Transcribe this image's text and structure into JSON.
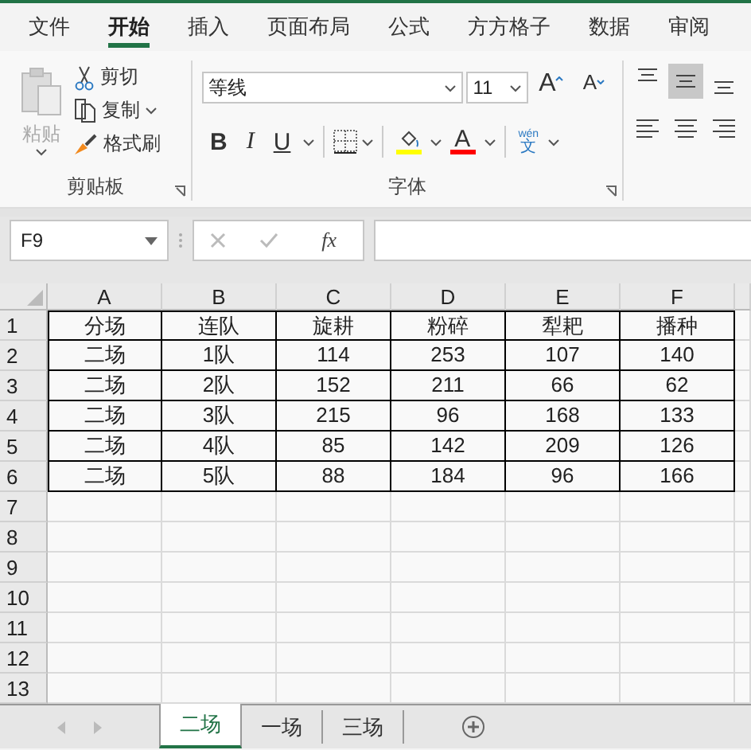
{
  "menu_tabs": [
    {
      "label": "文件",
      "selected": false
    },
    {
      "label": "开始",
      "selected": true
    },
    {
      "label": "插入",
      "selected": false
    },
    {
      "label": "页面布局",
      "selected": false
    },
    {
      "label": "公式",
      "selected": false
    },
    {
      "label": "方方格子",
      "selected": false
    },
    {
      "label": "数据",
      "selected": false
    },
    {
      "label": "审阅",
      "selected": false
    }
  ],
  "clipboard": {
    "paste": "粘贴",
    "cut": "剪切",
    "copy": "复制",
    "format_painter": "格式刷",
    "label": "剪贴板"
  },
  "font": {
    "name": "等线",
    "size": "11",
    "grow": "A",
    "shrink": "A",
    "bold": "B",
    "italic": "I",
    "underline": "U",
    "font_color": "A",
    "phonetic_top": "wén",
    "phonetic_bottom": "文",
    "label": "字体"
  },
  "alignment": [
    {
      "selected": false
    },
    {
      "selected": true
    },
    {
      "selected": false
    }
  ],
  "name_box": "F9",
  "formula_button": "fx",
  "sheet": {
    "columns": [
      "A",
      "B",
      "C",
      "D",
      "E",
      "F"
    ],
    "rows": [
      {
        "number": "1",
        "cells": [
          "分场",
          "连队",
          "旋耕",
          "粉碎",
          "犁耙",
          "播种"
        ]
      },
      {
        "number": "2",
        "cells": [
          "二场",
          "1队",
          "114",
          "253",
          "107",
          "140"
        ]
      },
      {
        "number": "3",
        "cells": [
          "二场",
          "2队",
          "152",
          "211",
          "66",
          "62"
        ]
      },
      {
        "number": "4",
        "cells": [
          "二场",
          "3队",
          "215",
          "96",
          "168",
          "133"
        ]
      },
      {
        "number": "5",
        "cells": [
          "二场",
          "4队",
          "85",
          "142",
          "209",
          "126"
        ]
      },
      {
        "number": "6",
        "cells": [
          "二场",
          "5队",
          "88",
          "184",
          "96",
          "166"
        ]
      },
      {
        "number": "7",
        "cells": []
      },
      {
        "number": "8",
        "cells": []
      },
      {
        "number": "9",
        "cells": []
      },
      {
        "number": "10",
        "cells": []
      },
      {
        "number": "11",
        "cells": []
      },
      {
        "number": "12",
        "cells": []
      },
      {
        "number": "13",
        "cells": []
      }
    ]
  },
  "sheet_tabs": [
    {
      "label": "二场",
      "selected": true
    },
    {
      "label": "一场",
      "selected": false
    },
    {
      "label": "三场",
      "selected": false
    }
  ]
}
